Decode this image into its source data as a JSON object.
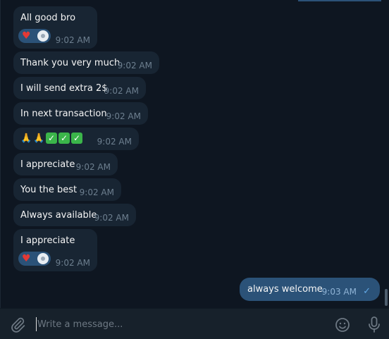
{
  "messages": [
    {
      "text": "All good bro",
      "time": "9:02 AM"
    },
    {
      "text": "Thank you very much",
      "time": "9:02 AM"
    },
    {
      "text": "I will send extra 2$",
      "time": "9:02 AM"
    },
    {
      "text": "In next transaction",
      "time": "9:02 AM"
    },
    {
      "text": "🙏🙏✅✅✅",
      "time": "9:02 AM"
    },
    {
      "text": "I appreciate",
      "time": "9:02 AM"
    },
    {
      "text": "You the best",
      "time": "9:02 AM"
    },
    {
      "text": "Always available",
      "time": "9:02 AM"
    },
    {
      "text": "I appreciate",
      "time": "9:02 AM"
    }
  ],
  "reaction": {
    "emoji": "♥"
  },
  "emoji_row": {
    "pray": "🙏",
    "check": "✓"
  },
  "outgoing": {
    "text": "always welcome",
    "time": "9:03 AM",
    "status": "✓"
  },
  "composer": {
    "placeholder": "Write a message..."
  },
  "icons": {
    "attach": "paperclip-icon",
    "emoji": "smiley-icon",
    "mic": "microphone-icon",
    "read": "check-icon"
  },
  "colors": {
    "background": "#0e1621",
    "incoming_bubble": "#182533",
    "outgoing_bubble": "#2b5278",
    "composer": "#17212b",
    "time": "#6d7f8f"
  }
}
